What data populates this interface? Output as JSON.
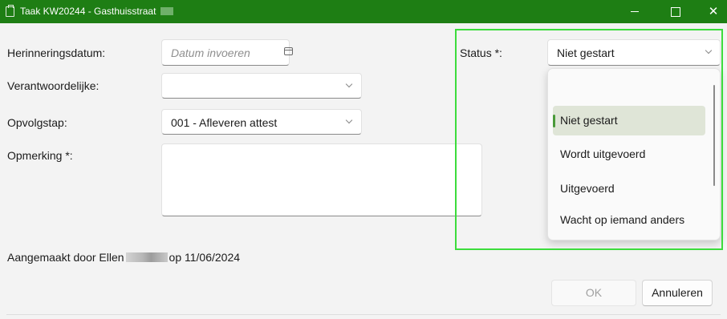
{
  "window": {
    "title": "Taak KW20244 - Gasthuisstraat",
    "close_glyph": "✕"
  },
  "form": {
    "reminder_label": "Herinneringsdatum:",
    "reminder_placeholder": "Datum invoeren",
    "responsible_label": "Verantwoordelijke:",
    "responsible_value": "",
    "followup_label": "Opvolgstap:",
    "followup_value": "001 - Afleveren attest",
    "remark_label": "Opmerking *:",
    "remark_value": "",
    "status_label": "Status *:",
    "status_value": "Niet gestart",
    "created_prefix": "Aangemaakt door Ellen",
    "created_suffix": "op 11/06/2024"
  },
  "status_dropdown": {
    "options": [
      {
        "label": "Niet gestart",
        "selected": true
      },
      {
        "label": "Wordt uitgevoerd",
        "selected": false
      },
      {
        "label": "Uitgevoerd",
        "selected": false
      },
      {
        "label": "Wacht op iemand anders",
        "selected": false
      }
    ]
  },
  "buttons": {
    "ok_label": "OK",
    "cancel_label": "Annuleren"
  },
  "colors": {
    "titlebar": "#1e7e14",
    "highlight": "#3cdc3c",
    "selection_indicator": "#4a9a3a"
  }
}
